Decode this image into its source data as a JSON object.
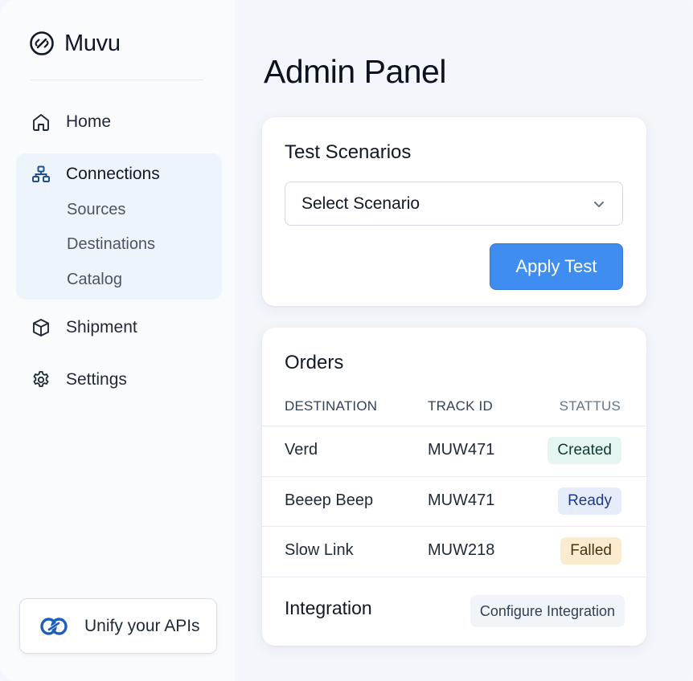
{
  "brand": {
    "name": "Muvu",
    "icon": "link-circle-icon"
  },
  "sidebar": {
    "items": [
      {
        "label": "Home",
        "icon": "home-icon"
      },
      {
        "label": "Connections",
        "icon": "network-icon"
      },
      {
        "label": "Shipment",
        "icon": "box-icon"
      },
      {
        "label": "Settings",
        "icon": "gear-icon"
      }
    ],
    "connections_sub": [
      {
        "label": "Sources"
      },
      {
        "label": "Destinations"
      },
      {
        "label": "Catalog"
      }
    ],
    "promo": {
      "label": "Unify your APIs",
      "icon": "unify-link-icon"
    }
  },
  "main": {
    "title": "Admin Panel",
    "scenarios": {
      "title": "Test Scenarios",
      "select_value": "Select Scenario",
      "apply_label": "Apply Test"
    },
    "orders": {
      "title": "Orders",
      "columns": [
        "DESTINATION",
        "TRACK ID",
        "STATTUS"
      ],
      "rows": [
        {
          "destination": "Verd",
          "track_id": "MUW471",
          "status": "Created"
        },
        {
          "destination": "Beeep Beep",
          "track_id": "MUW471",
          "status": "Ready"
        },
        {
          "destination": "Slow Link",
          "track_id": "MUW218",
          "status": "Falled"
        }
      ],
      "integration_label": "Integration",
      "configure_label": "Configure Integration"
    }
  },
  "colors": {
    "accent": "#3f8df0",
    "icon_blue": "#1d4f91",
    "created_bg": "#e5f6f2",
    "ready_bg": "#e7ecfa",
    "failed_bg": "#fbecd0"
  }
}
